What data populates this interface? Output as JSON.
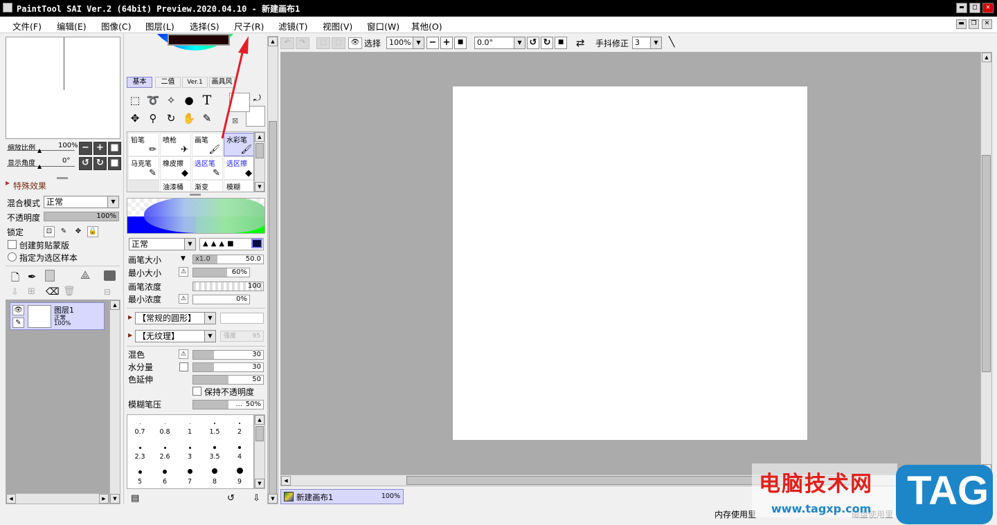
{
  "window": {
    "title": "PaintTool SAI Ver.2 (64bit) Preview.2020.04.10 - 新建画布1",
    "min_glyph": "▬",
    "max_glyph": "□",
    "close_glyph": "✕",
    "mdi_min_glyph": "▬",
    "mdi_restore_glyph": "❐",
    "mdi_close_glyph": "✕"
  },
  "menu": [
    "文件(F)",
    "编辑(E)",
    "图像(C)",
    "图层(L)",
    "选择(S)",
    "尺子(R)",
    "滤镜(T)",
    "视图(V)",
    "窗口(W)",
    "其他(O)"
  ],
  "navigator": {
    "zoom_label": "缩放比例",
    "zoom_value": "100%",
    "zoom_fraction": 1.0,
    "angle_label": "显示角度",
    "angle_value": "0°"
  },
  "effects": {
    "header": "特殊效果"
  },
  "layer_props": {
    "blend_label": "混合模式",
    "blend_value": "正常",
    "opacity_label": "不透明度",
    "opacity_value": "100%",
    "opacity_fraction": 1.0,
    "lock_label": "锁定",
    "clip_label": "创建剪贴蒙版",
    "selection_source_label": "指定为选区样本"
  },
  "layers": [
    {
      "name": "图层1",
      "mode": "正常",
      "opacity": "100%"
    }
  ],
  "tool_tabs": [
    "基本",
    "二值",
    "Ver.1",
    "画具风"
  ],
  "tools": [
    {
      "name": "rect-select-icon",
      "glyph": "⬚"
    },
    {
      "name": "lasso-icon",
      "glyph": "➰"
    },
    {
      "name": "magic-wand-icon",
      "glyph": "✧"
    },
    {
      "name": "shape-icon",
      "glyph": "●"
    },
    {
      "name": "text-tool-icon",
      "glyph": "T"
    },
    {
      "name": "move-icon",
      "glyph": "✥"
    },
    {
      "name": "zoom-icon",
      "glyph": "⚲"
    },
    {
      "name": "rotate-icon",
      "glyph": "↻"
    },
    {
      "name": "hand-icon",
      "glyph": "✋"
    },
    {
      "name": "eyedropper-icon",
      "glyph": "✎"
    }
  ],
  "brushes": [
    {
      "name": "铅笔",
      "glyph": "✏",
      "selected": false,
      "blue": false
    },
    {
      "name": "喷枪",
      "glyph": "✈",
      "selected": false,
      "blue": false
    },
    {
      "name": "画笔",
      "glyph": "🖌",
      "selected": false,
      "blue": false
    },
    {
      "name": "水彩笔",
      "glyph": "🖌",
      "selected": true,
      "blue": false
    },
    {
      "name": "马克笔",
      "glyph": "✎",
      "selected": false,
      "blue": false
    },
    {
      "name": "橡皮擦",
      "glyph": "◆",
      "selected": false,
      "blue": false
    },
    {
      "name": "选区笔",
      "glyph": "✎",
      "selected": false,
      "blue": true
    },
    {
      "name": "选区擦",
      "glyph": "◆",
      "selected": false,
      "blue": true
    },
    {
      "name": "",
      "glyph": "",
      "selected": false,
      "blue": false
    },
    {
      "name": "油漆桶",
      "glyph": "",
      "selected": false,
      "blue": false
    },
    {
      "name": "渐变",
      "glyph": "",
      "selected": false,
      "blue": false
    },
    {
      "name": "模糊",
      "glyph": "",
      "selected": false,
      "blue": false
    }
  ],
  "brush_settings": {
    "mode_value": "正常",
    "size_label": "画笔大小",
    "size_multiplier": "x1.0",
    "size_value": "50.0",
    "size_fraction": 0.35,
    "min_size_label": "最小大小",
    "min_size_value": "60%",
    "min_size_fraction": 0.6,
    "density_label": "画笔浓度",
    "density_value": "100",
    "density_fraction": 1.0,
    "min_density_label": "最小浓度",
    "min_density_value": "0%",
    "min_density_fraction": 0.0,
    "shape_value": "【常规的圆形】",
    "texture_value": "【无纹理】",
    "texture_strength_label": "强度",
    "texture_strength_value": "95",
    "blend_label": "混色",
    "blend_value": "30",
    "blend_fraction": 0.3,
    "water_label": "水分量",
    "water_value": "30",
    "water_fraction": 0.3,
    "stretch_label": "色延伸",
    "stretch_value": "50",
    "stretch_fraction": 0.5,
    "keep_opacity_label": "保持不透明度",
    "blur_pressure_label": "模糊笔压",
    "blur_pressure_value": "50%",
    "blur_pressure_dots": "...",
    "blur_pressure_fraction": 0.5
  },
  "brush_sizes": [
    "0.7",
    "0.8",
    "1",
    "1.5",
    "2",
    "2.3",
    "2.6",
    "3",
    "3.5",
    "4",
    "5",
    "6",
    "7",
    "8",
    "9"
  ],
  "toolbar": {
    "selection_label": "选择",
    "zoom_value": "100%",
    "angle_value": "0.0°",
    "stabilizer_label": "手抖修正",
    "stabilizer_value": "3"
  },
  "canvas_tabs": [
    {
      "name": "新建画布1",
      "zoom": "100%"
    }
  ],
  "status": {
    "memory_label": "内存使用里",
    "disk_label": "磁盘使用里"
  },
  "watermark": {
    "site_name": "电脑技术网",
    "url": "www.tagxp.com",
    "logo_text": "TAG"
  },
  "colors": {
    "workspace": "#ababab",
    "panel": "#f0f0f0",
    "selection": "#d8d8ff",
    "annotation_arrow": "#e21f26",
    "watermark_red": "#e0201b",
    "logo_blue": "#1d86c8"
  }
}
